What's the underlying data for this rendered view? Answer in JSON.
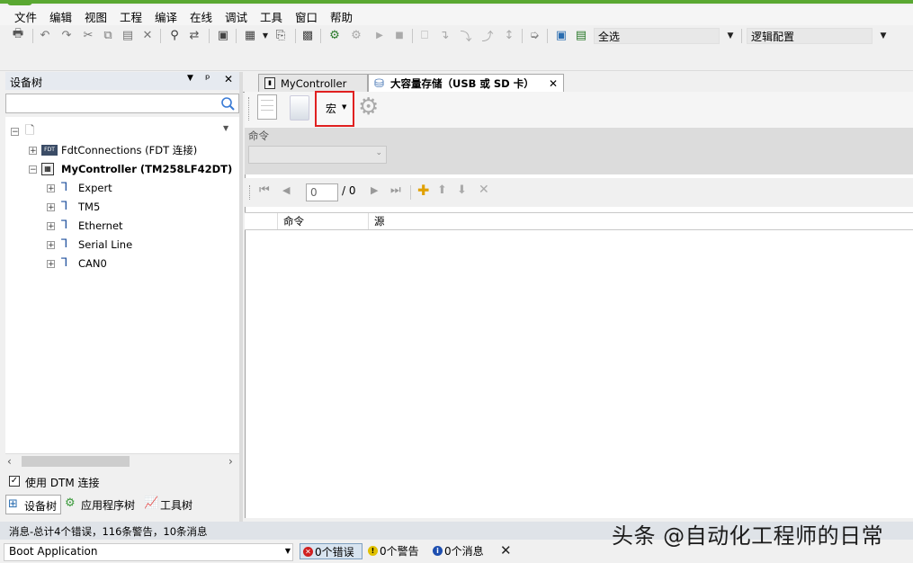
{
  "menu": [
    "文件",
    "编辑",
    "视图",
    "工程",
    "编译",
    "在线",
    "调试",
    "工具",
    "窗口",
    "帮助"
  ],
  "toolbar": {
    "select_all_combo": "全选",
    "config_combo": "逻辑配置"
  },
  "left_panel": {
    "title": "设备树",
    "pin_glyph": "ᵖ",
    "close_glyph": "✕",
    "tree": {
      "root_label": "",
      "fdt": "FdtConnections (FDT 连接)",
      "controller": "MyController (TM258LF42DT)",
      "children": [
        "Expert",
        "TM5",
        "Ethernet",
        "Serial Line",
        "CAN0"
      ]
    },
    "dtm_checkbox_label": "使用 DTM 连接",
    "bottom_tabs": [
      "设备树",
      "应用程序树",
      "工具树"
    ]
  },
  "doc_tabs": {
    "tab1": "MyController",
    "tab2": "大容量存储（USB 或 SD 卡）",
    "close_glyph": "✕"
  },
  "editor": {
    "macro_label": "宏",
    "command_label": "命令",
    "page_value": "0",
    "page_total": "/ 0",
    "columns": [
      "命令",
      "源"
    ]
  },
  "status": {
    "summary": "消息-总计4个错误，116条警告，10条消息",
    "app_combo": "Boot Application",
    "errors": "0个错误",
    "warnings": "0个警告",
    "messages": "0个消息"
  },
  "watermark": "头条 @自动化工程师的日常",
  "colors": {
    "title_green": "#5aa832",
    "highlight_red": "#e02020"
  }
}
